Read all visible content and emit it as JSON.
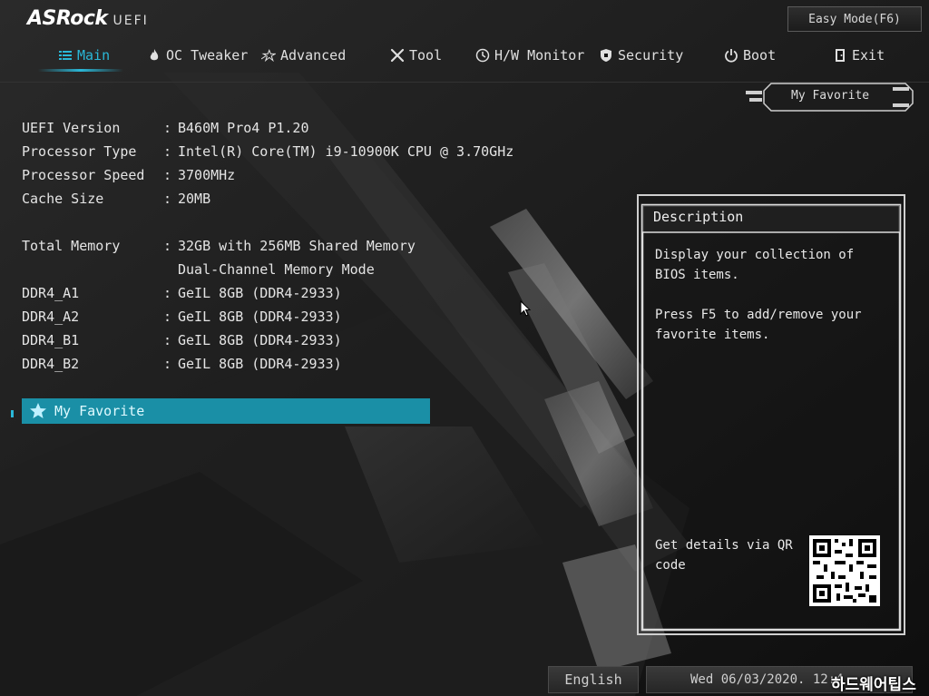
{
  "header": {
    "brand": "ASRock",
    "brand_suffix": "UEFI",
    "easy_mode_label": "Easy Mode(F6)"
  },
  "nav": {
    "tabs": [
      {
        "label": "Main",
        "icon": "list-icon",
        "active": true
      },
      {
        "label": "OC Tweaker",
        "icon": "flame-icon"
      },
      {
        "label": "Advanced",
        "icon": "star-icon"
      },
      {
        "label": "Tool",
        "icon": "wrench-icon"
      },
      {
        "label": "H/W Monitor",
        "icon": "monitor-icon"
      },
      {
        "label": "Security",
        "icon": "shield-icon"
      },
      {
        "label": "Boot",
        "icon": "power-icon"
      },
      {
        "label": "Exit",
        "icon": "exit-door-icon"
      }
    ]
  },
  "my_favorite_button": "My Favorite",
  "system_info": [
    {
      "label": "UEFI Version",
      "value": "B460M Pro4 P1.20"
    },
    {
      "label": "Processor Type",
      "value": "Intel(R) Core(TM) i9-10900K CPU @ 3.70GHz"
    },
    {
      "label": "Processor Speed",
      "value": "3700MHz"
    },
    {
      "label": "Cache Size",
      "value": "20MB"
    },
    {
      "label": "Total Memory",
      "value": "32GB with 256MB Shared Memory",
      "value2": "Dual-Channel Memory Mode"
    },
    {
      "label": "DDR4_A1",
      "value": "GeIL 8GB (DDR4-2933)"
    },
    {
      "label": "DDR4_A2",
      "value": "GeIL 8GB (DDR4-2933)"
    },
    {
      "label": "DDR4_B1",
      "value": "GeIL 8GB (DDR4-2933)"
    },
    {
      "label": "DDR4_B2",
      "value": "GeIL 8GB (DDR4-2933)"
    }
  ],
  "favorite_item": "My Favorite",
  "description": {
    "title": "Description",
    "paragraphs": [
      "Display your collection of BIOS items.",
      "Press F5 to add/remove your favorite items."
    ],
    "qr_label": "Get details via QR code"
  },
  "footer": {
    "language": "English",
    "datetime": "Wed 06/03/2020. 12:4"
  },
  "watermark": "하드웨어팁스",
  "colors": {
    "accent": "#2ab8d8",
    "selection": "#1a8fa6",
    "background": "#141414"
  }
}
